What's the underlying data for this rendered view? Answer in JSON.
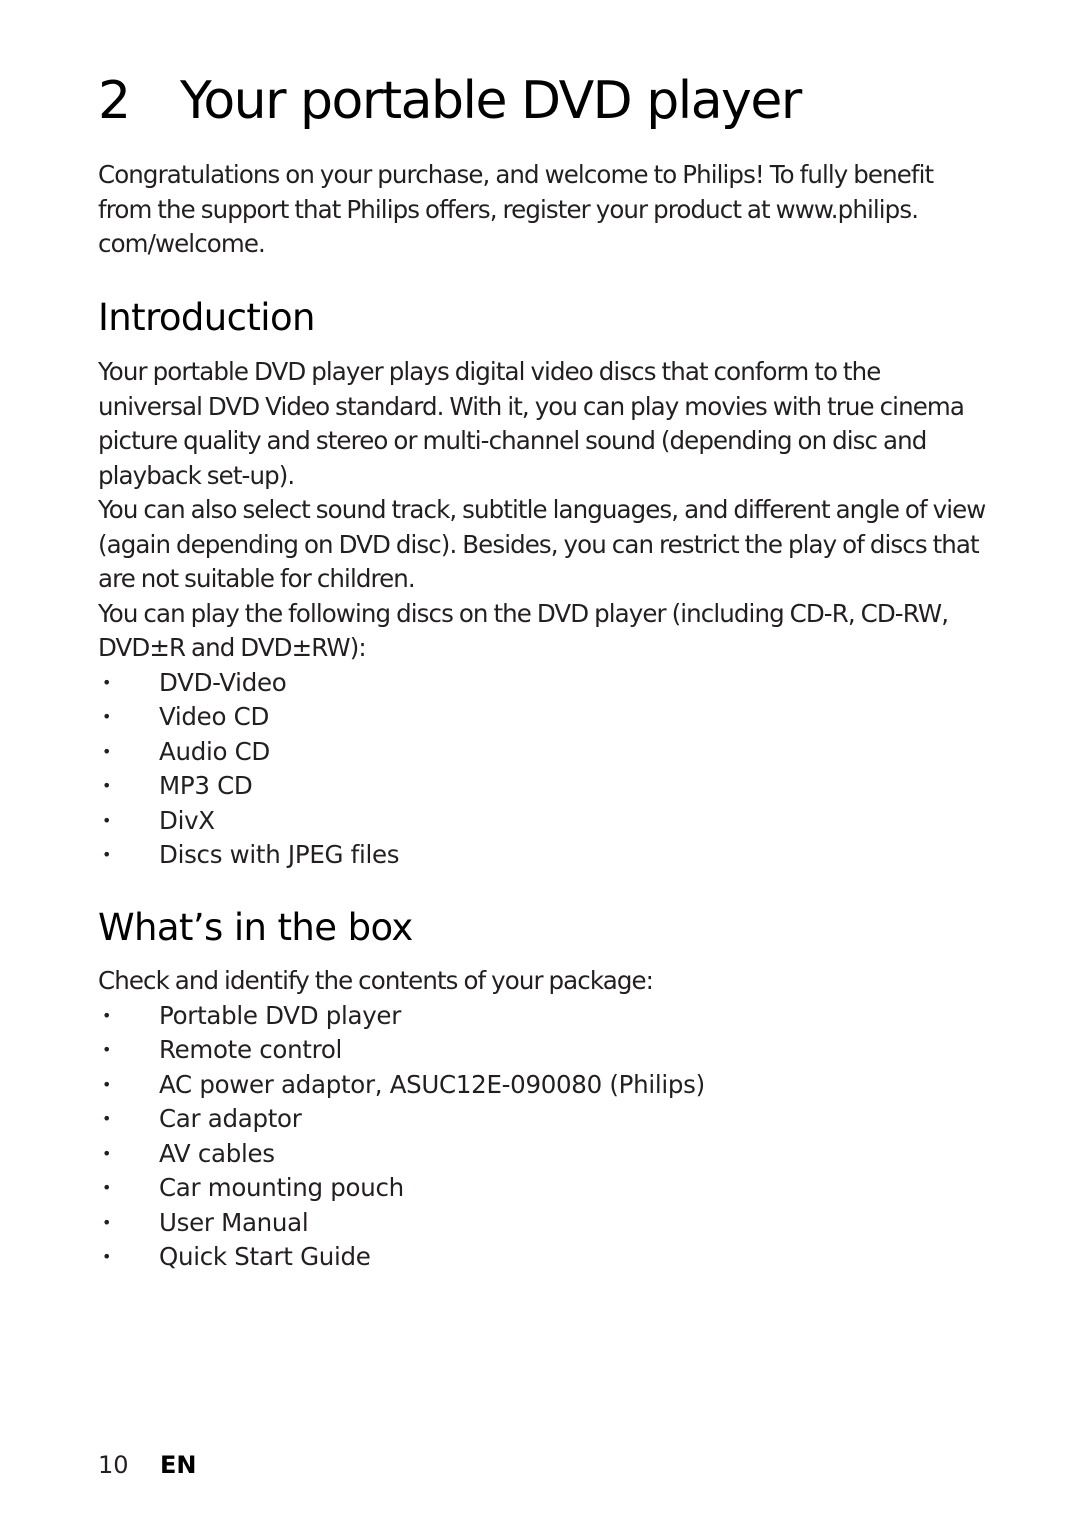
{
  "chapter": {
    "number": "2",
    "title": "Your portable DVD player"
  },
  "intro_paragraph": "Congratulations on your purchase, and welcome to Philips! To fully benefit from the support that Philips offers, register your product at www.philips. com/welcome.",
  "sections": {
    "introduction": {
      "heading": "Introduction",
      "paragraphs": [
        "Your portable DVD player plays digital video discs that conform to the universal DVD Video standard. With it, you can play movies with true cinema picture quality and stereo or multi-channel sound (depending on disc and playback set-up).",
        "You can also select sound track, subtitle languages, and different angle of view (again depending on DVD disc). Besides, you can restrict the play of discs that are not suitable for children.",
        "You can play the following discs on the DVD player (including CD-R, CD-RW, DVD±R and DVD±RW):"
      ],
      "bullet_glyph": "•",
      "disc_types": [
        "DVD-Video",
        "Video CD",
        "Audio CD",
        "MP3 CD",
        "DivX",
        "Discs with JPEG files"
      ]
    },
    "whats_in_the_box": {
      "heading": "What’s in the box",
      "lead": "Check and identify the contents of your package:",
      "bullet_glyph": "•",
      "items": [
        "Portable DVD player",
        "Remote control",
        "AC power adaptor, ASUC12E-090080 (Philips)",
        "Car adaptor",
        "AV cables",
        "Car mounting pouch",
        "User Manual",
        "Quick Start Guide"
      ]
    }
  },
  "footer": {
    "page_number": "10",
    "language": "EN"
  }
}
